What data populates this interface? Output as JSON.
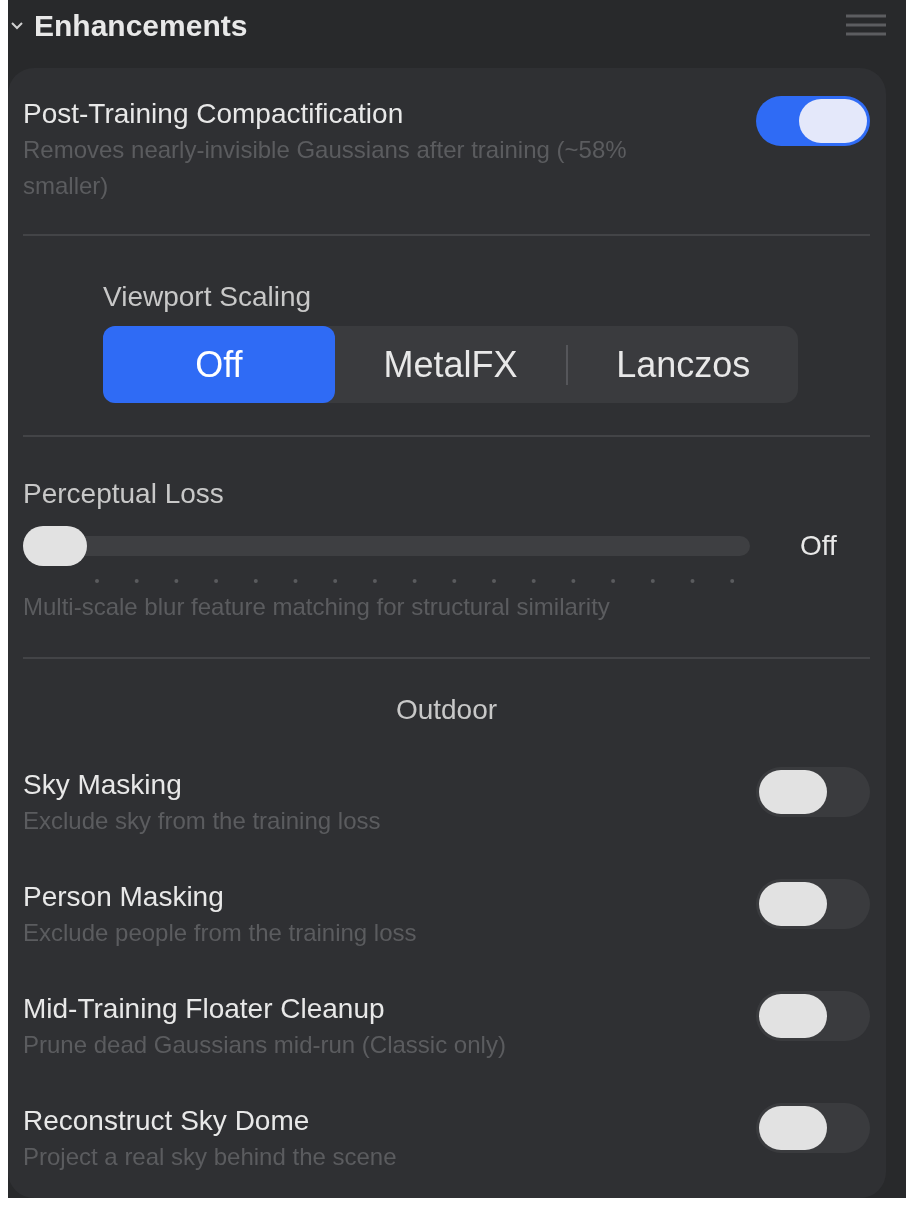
{
  "section": {
    "title": "Enhancements",
    "expanded": true
  },
  "compaction": {
    "title": "Post-Training Compactification",
    "description": "Removes nearly-invisible Gaussians after training (~58% smaller)",
    "on": true
  },
  "viewport_scaling": {
    "label": "Viewport Scaling",
    "options": [
      {
        "label": "Off",
        "selected": true
      },
      {
        "label": "MetalFX",
        "selected": false
      },
      {
        "label": "Lanczos",
        "selected": false
      }
    ]
  },
  "perceptual_loss": {
    "label": "Perceptual Loss",
    "level": 0,
    "reading": "Off",
    "description": "Multi-scale blur feature matching for structural similarity"
  },
  "outdoor": {
    "heading": "Outdoor",
    "toggles": [
      {
        "title": "Sky Masking",
        "description": "Exclude sky from the training loss",
        "on": false
      },
      {
        "title": "Person Masking",
        "description": "Exclude people from the training loss",
        "on": false
      },
      {
        "title": "Mid-Training Floater Cleanup",
        "description": "Prune dead Gaussians mid-run (Classic only)",
        "on": false
      },
      {
        "title": "Reconstruct Sky Dome",
        "description": "Project a real sky behind the scene",
        "on": false
      }
    ]
  }
}
